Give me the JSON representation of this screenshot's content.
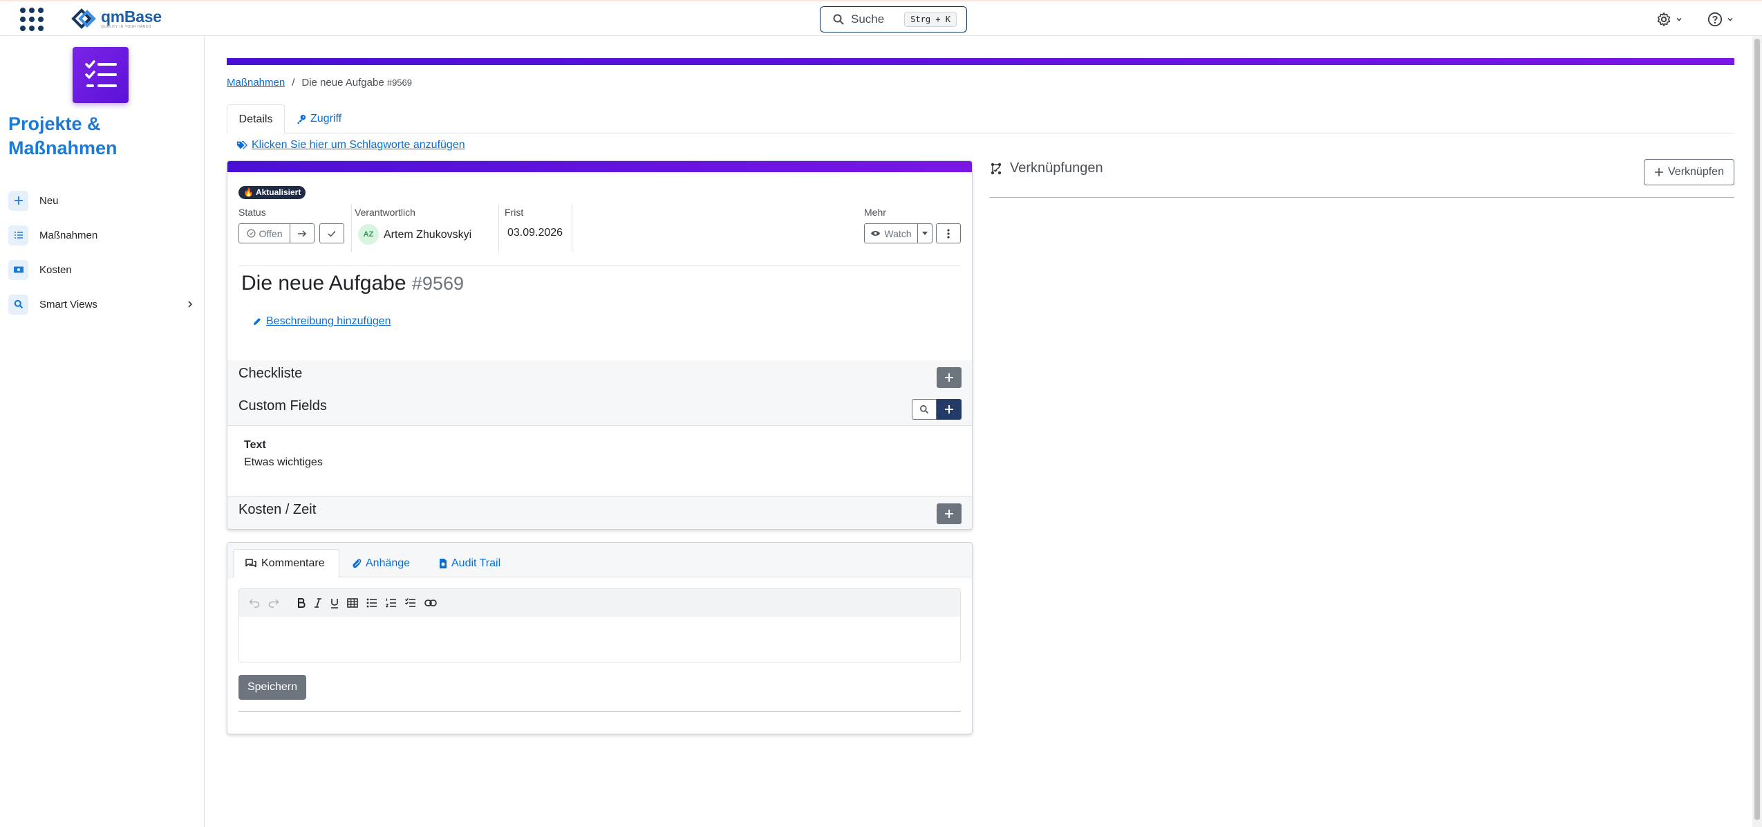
{
  "topbar": {
    "logo_brand": "qmBase",
    "logo_tagline": "QUALITY IN YOUR HANDS",
    "search_label": "Suche",
    "search_shortcut": "Strg + K"
  },
  "sidebar": {
    "title": "Projekte & Maßnahmen",
    "items": [
      {
        "label": "Neu",
        "icon": "plus-icon"
      },
      {
        "label": "Maßnahmen",
        "icon": "list-icon"
      },
      {
        "label": "Kosten",
        "icon": "money-icon"
      },
      {
        "label": "Smart Views",
        "icon": "search-icon"
      }
    ]
  },
  "breadcrumb": {
    "parent": "Maßnahmen",
    "separator": "/",
    "current": "Die neue Aufgabe",
    "current_number": "#9569"
  },
  "tabs": {
    "details": "Details",
    "access": "Zugriff"
  },
  "tags_link": "Klicken Sie hier um Schlagworte anzufügen",
  "task": {
    "badge": "Aktualisiert",
    "status_label": "Status",
    "status_value": "Offen",
    "owner_label": "Verantwortlich",
    "owner_initials": "AZ",
    "owner_name": "Artem Zhukovskyi",
    "due_label": "Frist",
    "due_value": "03.09.2026",
    "more_label": "Mehr",
    "watch_label": "Watch",
    "title": "Die neue Aufgabe",
    "number": "#9569",
    "description_link": "Beschreibung hinzufügen",
    "checklist_title": "Checkliste",
    "custom_fields_title": "Custom Fields",
    "custom_field_name": "Text",
    "custom_field_value": "Etwas wichtiges",
    "cost_title": "Kosten / Zeit"
  },
  "comments": {
    "tab_comments": "Kommentare",
    "tab_attachments": "Anhänge",
    "tab_audit": "Audit Trail",
    "save_label": "Speichern"
  },
  "links": {
    "title": "Verknüpfungen",
    "button_label": "Verknüpfen"
  },
  "colors": {
    "accent_purple": "#5b12d6",
    "link_blue": "#0a6ed1",
    "navy": "#14375e"
  }
}
